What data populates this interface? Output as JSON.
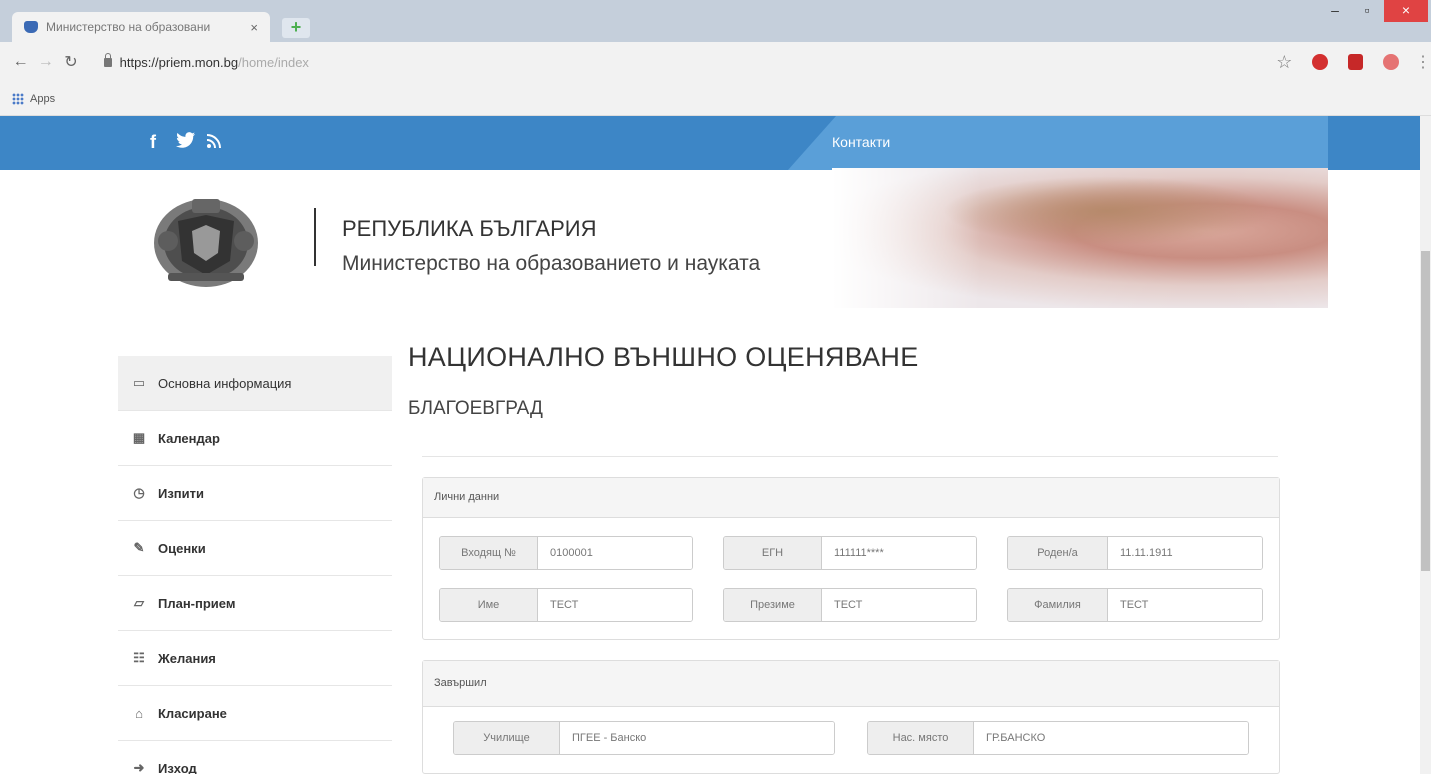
{
  "browser": {
    "tab_title": "Министерство на образовани",
    "tab_close": "×",
    "new_tab": "+",
    "url_host": "https://priem.mon.bg",
    "url_path": "/home/index",
    "bookmarks_apps": "Apps"
  },
  "header": {
    "contacts": "Контакти",
    "republic": "РЕПУБЛИКА БЪЛГАРИЯ",
    "ministry": "Министерство на образованието и науката"
  },
  "sidebar": {
    "items": [
      {
        "label": "Основна информация",
        "icon": "monitor-icon"
      },
      {
        "label": "Календар",
        "icon": "calendar-icon"
      },
      {
        "label": "Изпити",
        "icon": "stopwatch-icon"
      },
      {
        "label": "Оценки",
        "icon": "edit-icon"
      },
      {
        "label": "План-прием",
        "icon": "folder-icon"
      },
      {
        "label": "Желания",
        "icon": "list-icon"
      },
      {
        "label": "Класиране",
        "icon": "institution-icon"
      },
      {
        "label": "Изход",
        "icon": "signout-icon"
      }
    ]
  },
  "main": {
    "title": "НАЦИОНАЛНО ВЪНШНО ОЦЕНЯВАНЕ",
    "subtitle": "БЛАГОЕВГРАД"
  },
  "personal": {
    "heading": "Лични данни",
    "incoming_label": "Входящ №",
    "incoming_value": "0100001",
    "egn_label": "ЕГН",
    "egn_value": "111111****",
    "born_label": "Роден/а",
    "born_value": "11.11.1911",
    "name_label": "Име",
    "name_value": "ТЕСТ",
    "middle_label": "Презиме",
    "middle_value": "ТЕСТ",
    "family_label": "Фамилия",
    "family_value": "ТЕСТ"
  },
  "graduated": {
    "heading": "Завършил",
    "school_label": "Училище",
    "school_value": "ПГЕЕ - Банско",
    "place_label": "Нас. място",
    "place_value": "ГР.БАНСКО"
  }
}
